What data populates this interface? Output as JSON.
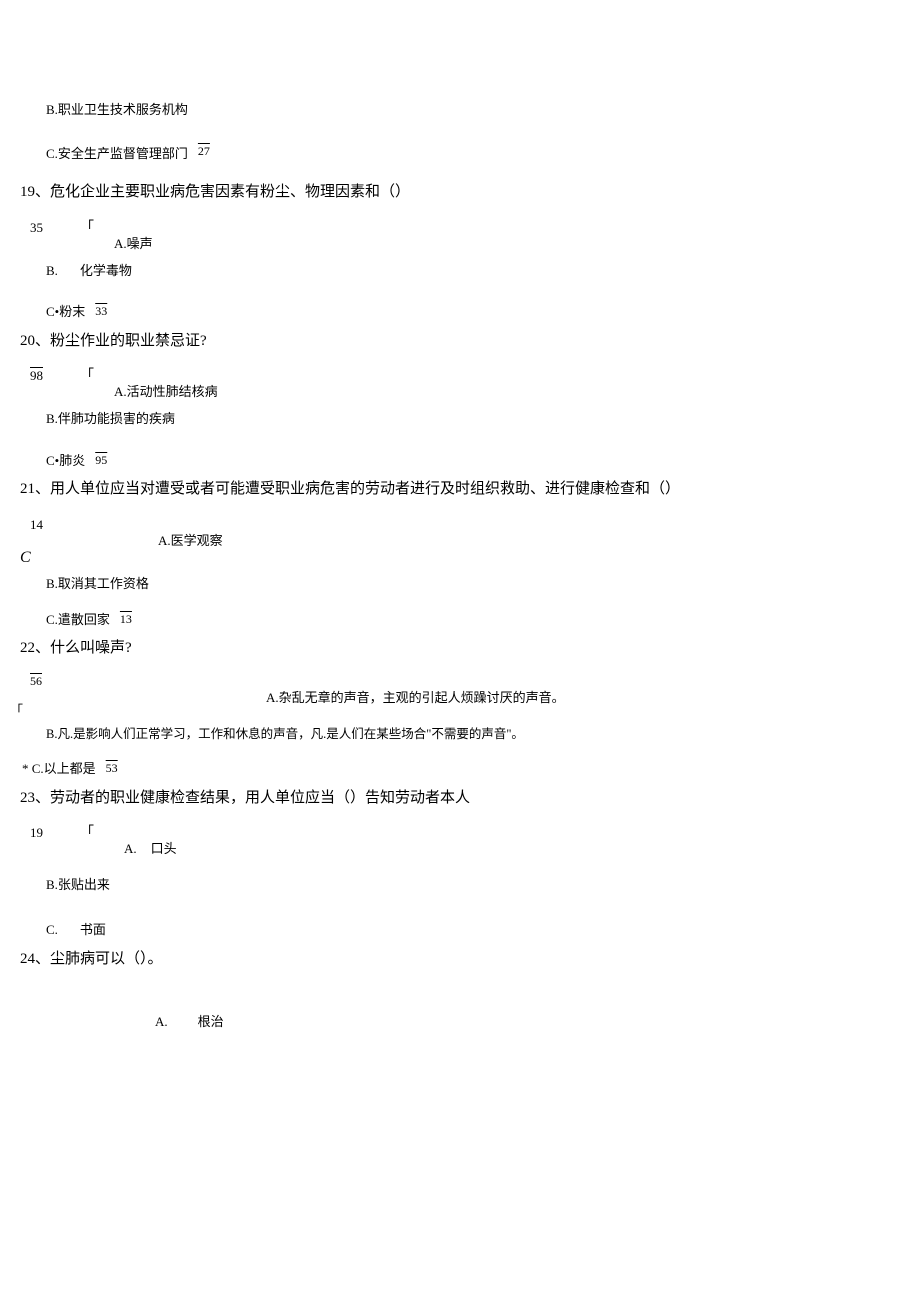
{
  "pre": {
    "optB": "B.职业卫生技术服务机构",
    "optC": "C.安全生产监督管理部门",
    "optC_num": "27"
  },
  "q19": {
    "title": "19、危化企业主要职业病危害因素有粉尘、物理因素和（）",
    "num": "35",
    "marker": "「",
    "optA": "A.噪声",
    "optB_label": "B.",
    "optB_text": "化学毒物",
    "optC": "C•粉末",
    "optC_num": "33"
  },
  "q20": {
    "title": "20、粉尘作业的职业禁忌证?",
    "num": "98",
    "marker": "「",
    "optA": "A.活动性肺结核病",
    "optB": "B.伴肺功能损害的疾病",
    "optC": "C•肺炎",
    "optC_num": "95"
  },
  "q21": {
    "title": "21、用人单位应当对遭受或者可能遭受职业病危害的劳动者进行及时组织救助、进行健康检查和（）",
    "num": "14",
    "optA": "A.医学观察",
    "italic": "C",
    "optB": "B.取消其工作资格",
    "optC": "C.遣散回家",
    "optC_num": "13"
  },
  "q22": {
    "title": "22、什么叫噪声?",
    "num": "56",
    "optA": "A.杂乱无章的声音，主观的引起人烦躁讨厌的声音。",
    "marker": "「",
    "optB": "B.凡.是影响人们正常学习，工作和休息的声音，凡.是人们在某些场合\"不需要的声音\"。",
    "optC": "* C.以上都是",
    "optC_num": "53"
  },
  "q23": {
    "title": "23、劳动者的职业健康检查结果，用人单位应当（）告知劳动者本人",
    "num": "19",
    "marker": "「",
    "optA_label": "A.",
    "optA_text": "口头",
    "optB": "B.张贴出来",
    "optC_label": "C.",
    "optC_text": "书面"
  },
  "q24": {
    "title": "24、尘肺病可以（）。",
    "optA_label": "A.",
    "optA_text": "根治"
  }
}
